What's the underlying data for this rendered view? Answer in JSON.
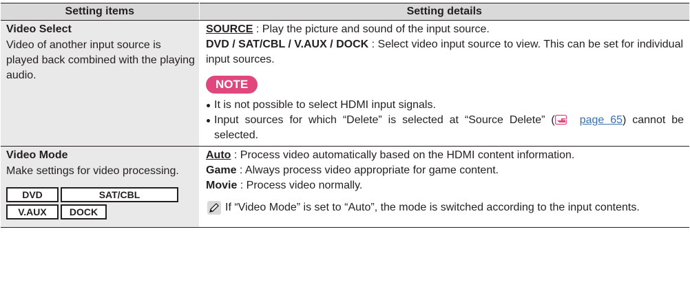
{
  "table": {
    "header": {
      "col_items": "Setting items",
      "col_details": "Setting details"
    },
    "rows": [
      {
        "item_title": "Video Select",
        "item_desc": "Video of another input source is played back combined with the playing audio.",
        "options": [
          {
            "label": "SOURCE",
            "text": " : Play the picture and sound of the input source."
          },
          {
            "label": "DVD / SAT/CBL / V.AUX / DOCK",
            "text": " : Select video input source to view. This can be set for individual input sources."
          }
        ],
        "note": {
          "badge": "NOTE",
          "items": [
            "It is not possible to select HDMI input signals.",
            "Input sources for which “Delete” is selected at “Source Delete” ("
          ],
          "ref_link": "page 65",
          "item2_tail": ") cannot be selected."
        }
      },
      {
        "item_title": "Video Mode",
        "item_desc": "Make settings for video processing.",
        "sources": {
          "row1": [
            "DVD",
            "SAT/CBL"
          ],
          "row2": [
            "V.AUX",
            "DOCK"
          ]
        },
        "options": [
          {
            "label": "Auto",
            "text": " : Process video automatically based on the HDMI content information."
          },
          {
            "label": "Game",
            "text": " : Always process video appropriate for game content."
          },
          {
            "label": "Movie",
            "text": " : Process video normally."
          }
        ],
        "tip": "If “Video Mode” is set to “Auto”, the mode is switched according to the input contents."
      }
    ]
  },
  "colors": {
    "header_bg": "#d9d9d9",
    "item_bg": "#e9e9e9",
    "note_badge": "#e0477d",
    "link": "#3a6fb0"
  },
  "icons": {
    "reference": "pointing-hand-icon",
    "tip": "pencil-icon"
  }
}
